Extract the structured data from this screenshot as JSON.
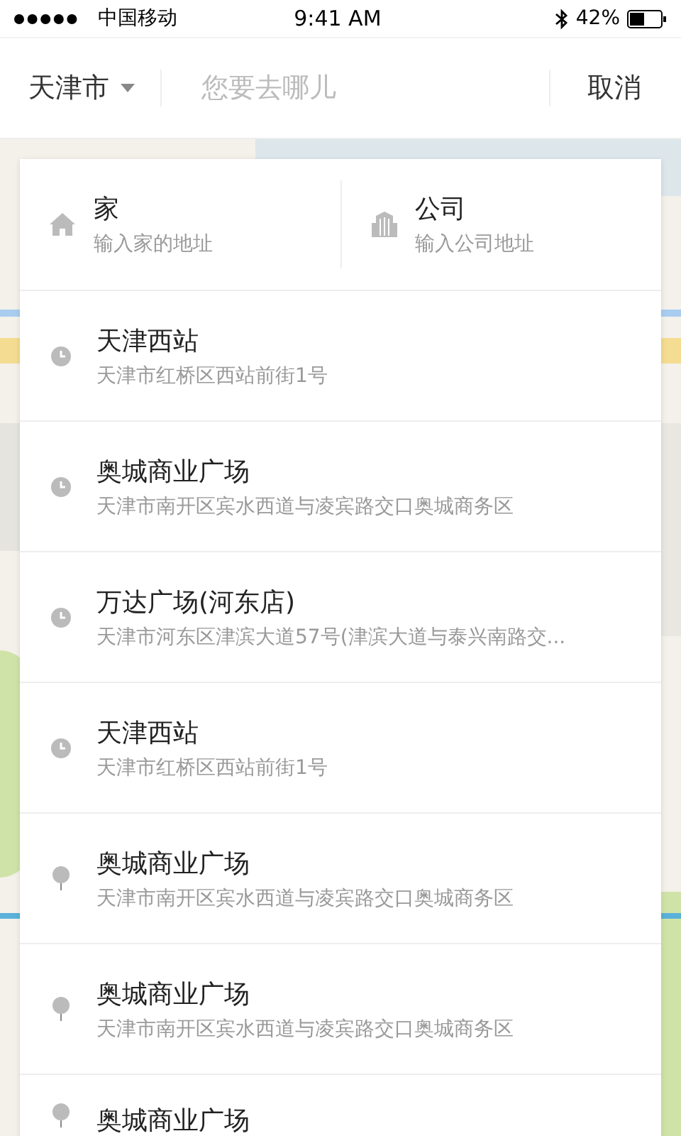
{
  "status_bar": {
    "carrier": "中国移动",
    "time": "9:41 AM",
    "battery": "42%"
  },
  "search_bar": {
    "city": "天津市",
    "placeholder": "您要去哪儿",
    "cancel": "取消"
  },
  "shortcuts": [
    {
      "kind": "home",
      "title": "家",
      "subtitle": "输入家的地址"
    },
    {
      "kind": "company",
      "title": "公司",
      "subtitle": "输入公司地址"
    }
  ],
  "results": [
    {
      "kind": "history",
      "title": "天津西站",
      "address": "天津市红桥区西站前街1号"
    },
    {
      "kind": "history",
      "title": "奥城商业广场",
      "address": "天津市南开区宾水西道与凌宾路交口奥城商务区"
    },
    {
      "kind": "history",
      "title": "万达广场(河东店)",
      "address": "天津市河东区津滨大道57号(津滨大道与泰兴南路交..."
    },
    {
      "kind": "history",
      "title": "天津西站",
      "address": "天津市红桥区西站前街1号"
    },
    {
      "kind": "place",
      "title": "奥城商业广场",
      "address": "天津市南开区宾水西道与凌宾路交口奥城商务区"
    },
    {
      "kind": "place",
      "title": "奥城商业广场",
      "address": "天津市南开区宾水西道与凌宾路交口奥城商务区"
    },
    {
      "kind": "place",
      "title": "奥城商业广场"
    }
  ]
}
